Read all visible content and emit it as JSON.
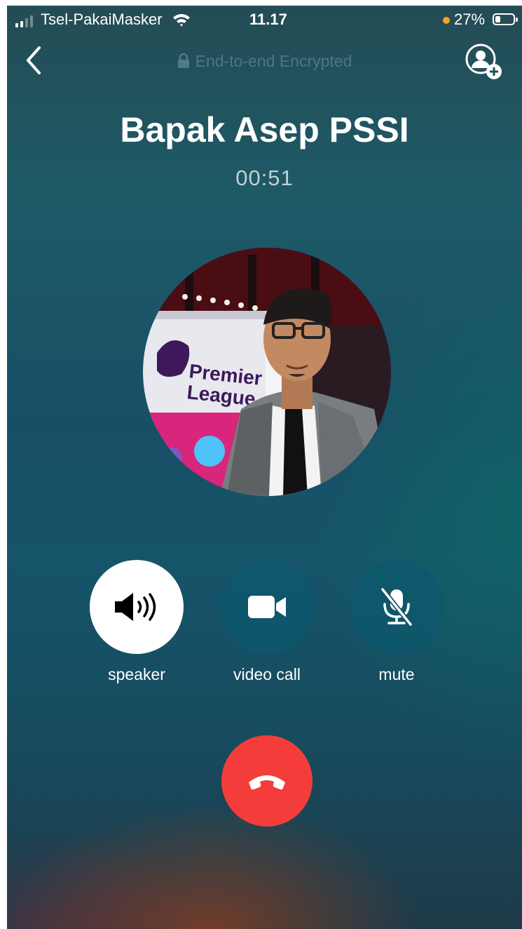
{
  "status_bar": {
    "carrier": "Tsel-PakaiMasker",
    "time": "11.17",
    "battery_percent": "27%",
    "signal_bars": 2,
    "battery_level": 0.27
  },
  "header": {
    "encryption_label": "End-to-end Encrypted"
  },
  "call": {
    "contact_name": "Bapak Asep PSSI",
    "duration": "00:51",
    "avatar_text": "Premier League"
  },
  "controls": {
    "speaker_label": "speaker",
    "video_label": "video call",
    "mute_label": "mute"
  },
  "colors": {
    "hangup": "#f43d3b",
    "battery_dot": "#f7a41d",
    "speaker_active_bg": "#ffffff"
  },
  "icons": [
    "signal-icon",
    "wifi-icon",
    "battery-icon",
    "back-icon",
    "lock-icon",
    "add-person-icon",
    "speaker-icon",
    "video-camera-icon",
    "microphone-off-icon",
    "end-call-icon"
  ]
}
